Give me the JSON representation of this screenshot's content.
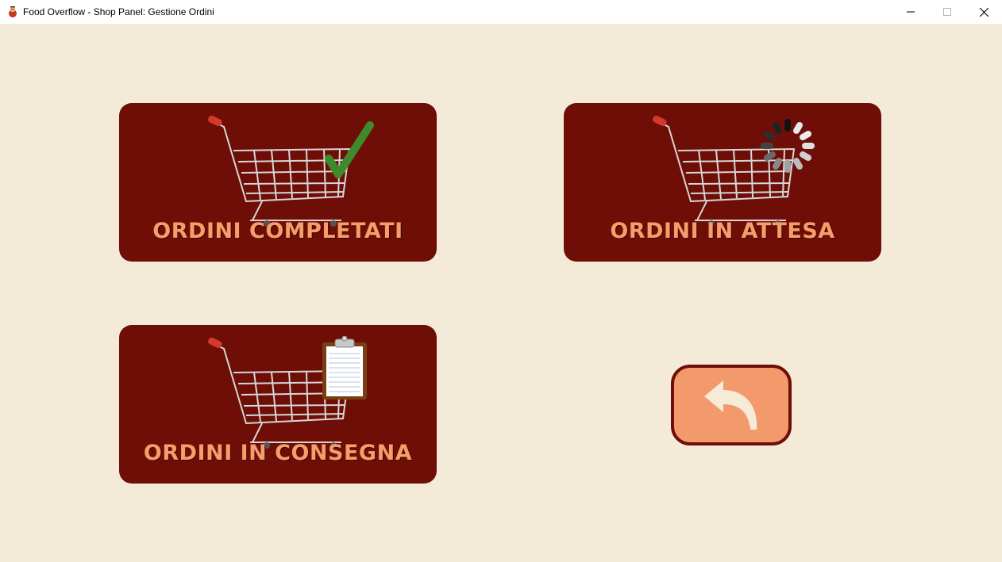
{
  "window": {
    "title": "Food Overflow - Shop Panel: Gestione Ordini",
    "app_icon": "food-overflow-logo-icon",
    "controls": [
      "minimize-icon",
      "maximize-icon",
      "close-icon"
    ]
  },
  "cards": {
    "completed": {
      "label": "ORDINI COMPLETATI",
      "icon": "cart-checkmark-icon"
    },
    "pending": {
      "label": "ORDINI IN ATTESA",
      "icon": "cart-loading-icon"
    },
    "delivery": {
      "label": "ORDINI IN CONSEGNA",
      "icon": "cart-clipboard-icon"
    }
  },
  "back_button": {
    "icon": "back-arrow-icon"
  },
  "colors": {
    "background": "#f3ebd8",
    "card": "#6f0e07",
    "label": "#f59e6b",
    "back_fill": "#f29a6c",
    "checkmark": "#3f8a2a"
  }
}
